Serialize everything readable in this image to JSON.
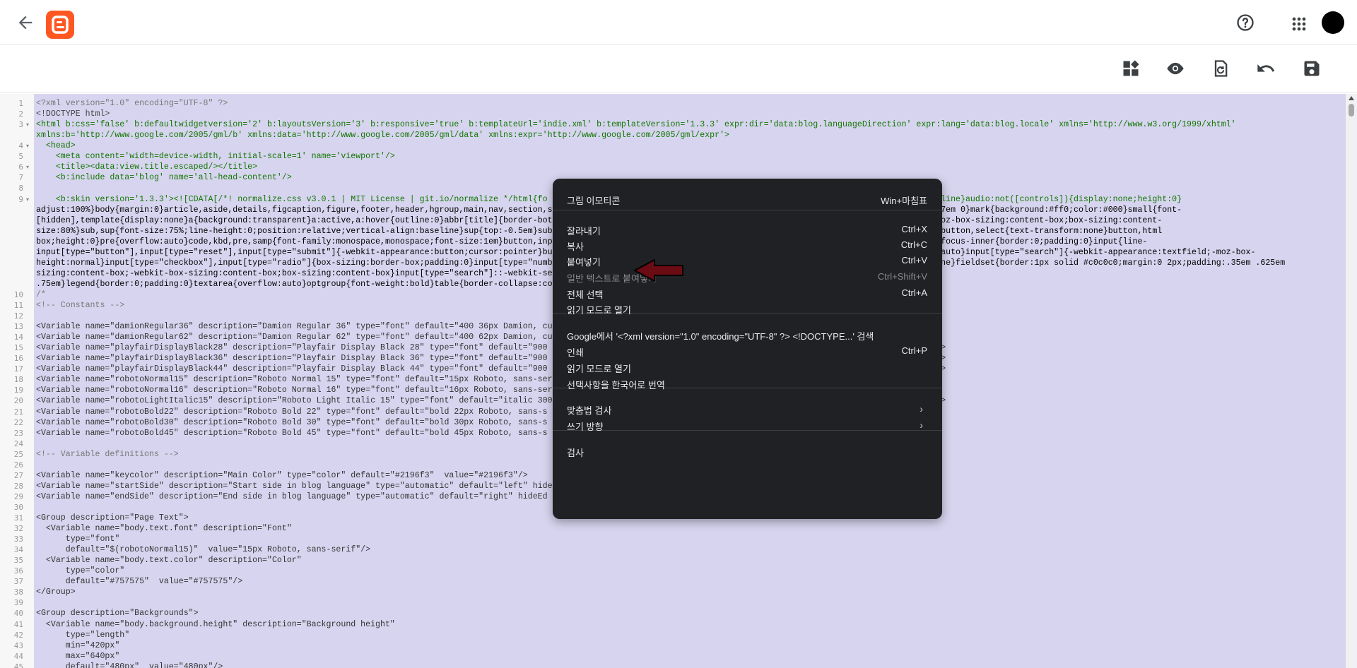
{
  "header": {
    "back_icon": "arrow-left-icon",
    "logo_icon": "blogger-logo-icon",
    "help_icon": "help-circle-icon",
    "apps_icon": "apps-grid-icon",
    "avatar_color": "#000000"
  },
  "toolbar": {
    "icons": [
      "widgets-icon",
      "preview-eye-icon",
      "restore-icon",
      "undo-icon",
      "save-icon"
    ]
  },
  "editor": {
    "lines": [
      {
        "n": "1",
        "fold": "",
        "text": "<?xml version=\"1.0\" encoding=\"UTF-8\" ?>",
        "color": "#777777"
      },
      {
        "n": "2",
        "fold": "",
        "text": "<!DOCTYPE html>",
        "color": "#444444"
      },
      {
        "n": "3",
        "fold": "▾",
        "text": "<html b:css='false' b:defaultwidgetversion='2' b:layoutsVersion='3' b:responsive='true' b:templateUrl='indie.xml' b:templateVersion='1.3.3' expr:dir='data:blog.languageDirection' expr:lang='data:blog.locale' xmlns='http://www.w3.org/1999/xhtml'",
        "color": "#117700"
      },
      {
        "n": "",
        "fold": "",
        "text": "xmlns:b='http://www.google.com/2005/gml/b' xmlns:data='http://www.google.com/2005/gml/data' xmlns:expr='http://www.google.com/2005/gml/expr'>",
        "color": "#117700"
      },
      {
        "n": "4",
        "fold": "▾",
        "text": "  <head>",
        "color": "#117700"
      },
      {
        "n": "5",
        "fold": "",
        "text": "    <meta content='width=device-width, initial-scale=1' name='viewport'/>",
        "color": "#117700"
      },
      {
        "n": "6",
        "fold": "▾",
        "text": "    <title><data:view.title.escaped/></title>",
        "color": "#117700"
      },
      {
        "n": "7",
        "fold": "",
        "text": "    <b:include data='blog' name='all-head-content'/>",
        "color": "#117700"
      },
      {
        "n": "8",
        "fold": "",
        "text": "",
        "color": "#000000"
      },
      {
        "n": "9",
        "fold": "▾",
        "text": "    <b:skin version='1.3.3'><![CDATA[/*! normalize.css v3.0.1 | MIT License | git.io/normalize */html{fo                                                                     -align:baseline}audio:not([controls]){display:none;height:0}",
        "color": "#117700"
      },
      {
        "n": "",
        "fold": "",
        "text": "adjust:100%}body{margin:0}article,aside,details,figcaption,figure,footer,header,hgroup,main,nav,section,s                                                                     ;margin:.67em 0}mark{background:#ff0;color:#000}small{font-",
        "color": "#000000"
      },
      {
        "n": "",
        "fold": "",
        "text": "[hidden],template{display:none}a{background:transparent}a:active,a:hover{outline:0}abbr[title]{border-bot                                                                     40px}hr{-moz-box-sizing:content-box;box-sizing:content-",
        "color": "#000000"
      },
      {
        "n": "",
        "fold": "",
        "text": "size:80%}sub,sup{font-size:75%;line-height:0;position:relative;vertical-align:baseline}sup{top:-0.5em}sub                                                                     w:visible}button,select{text-transform:none}button,html",
        "color": "#000000"
      },
      {
        "n": "",
        "fold": "",
        "text": "box;height:0}pre{overflow:auto}code,kbd,pre,samp{font-family:monospace,monospace;font-size:1em}button,inp                                                                     put::-moz-focus-inner{border:0;padding:0}input{line-",
        "color": "#000000"
      },
      {
        "n": "",
        "fold": "",
        "text": "input[type=\"button\"],input[type=\"reset\"],input[type=\"submit\"]{-webkit-appearance:button;cursor:pointer}bu                                                                     ::{height:auto}input[type=\"search\"]{-webkit-appearance:textfield;-moz-box-",
        "color": "#000000"
      },
      {
        "n": "",
        "fold": "",
        "text": "height:normal}input[type=\"checkbox\"],input[type=\"radio\"]{box-sizing:border-box;padding:0}input[type=\"numb                                                                     earance:none}fieldset{border:1px solid #c0c0c0;margin:0 2px;padding:.35em .625em",
        "color": "#000000"
      },
      {
        "n": "",
        "fold": "",
        "text": "sizing:content-box;-webkit-box-sizing:content-box;box-sizing:content-box}input[type=\"search\"]::-webkit-se",
        "color": "#000000"
      },
      {
        "n": "",
        "fold": "",
        "text": ".75em}legend{border:0;padding:0}textarea{overflow:auto}optgroup{font-weight:bold}table{border-collapse:co",
        "color": "#000000"
      },
      {
        "n": "10",
        "fold": "",
        "text": "/*",
        "color": "#777777"
      },
      {
        "n": "11",
        "fold": "",
        "text": "<!-- Constants -->",
        "color": "#777777"
      },
      {
        "n": "12",
        "fold": "",
        "text": "",
        "color": "#000000"
      },
      {
        "n": "13",
        "fold": "",
        "text": "<Variable name=\"damionRegular36\" description=\"Damion Regular 36\" type=\"font\" default=\"400 36px Damion, cu",
        "color": "#333333"
      },
      {
        "n": "14",
        "fold": "",
        "text": "<Variable name=\"damionRegular62\" description=\"Damion Regular 62\" type=\"font\" default=\"400 62px Damion, cu",
        "color": "#333333"
      },
      {
        "n": "15",
        "fold": "",
        "text": "<Variable name=\"playfairDisplayBlack28\" description=\"Playfair Display Black 28\" type=\"font\" default=\"900                                                                    lay, serif\"/>",
        "color": "#333333"
      },
      {
        "n": "16",
        "fold": "",
        "text": "<Variable name=\"playfairDisplayBlack36\" description=\"Playfair Display Black 36\" type=\"font\" default=\"900                                                                    lay, serif\"/>",
        "color": "#333333"
      },
      {
        "n": "17",
        "fold": "",
        "text": "<Variable name=\"playfairDisplayBlack44\" description=\"Playfair Display Black 44\" type=\"font\" default=\"900                                                                    lay, serif\"/>",
        "color": "#333333"
      },
      {
        "n": "18",
        "fold": "",
        "text": "<Variable name=\"robotoNormal15\" description=\"Roboto Normal 15\" type=\"font\" default=\"15px Roboto, sans-ser",
        "color": "#333333"
      },
      {
        "n": "19",
        "fold": "",
        "text": "<Variable name=\"robotoNormal16\" description=\"Roboto Normal 16\" type=\"font\" default=\"16px Roboto, sans-ser",
        "color": "#333333"
      },
      {
        "n": "20",
        "fold": "",
        "text": "<Variable name=\"robotoLightItalic15\" description=\"Roboto Light Italic 15\" type=\"font\" default=\"italic 300                                                                     ns-serif\"/>",
        "color": "#333333"
      },
      {
        "n": "21",
        "fold": "",
        "text": "<Variable name=\"robotoBold22\" description=\"Roboto Bold 22\" type=\"font\" default=\"bold 22px Roboto, sans-s",
        "color": "#333333"
      },
      {
        "n": "22",
        "fold": "",
        "text": "<Variable name=\"robotoBold30\" description=\"Roboto Bold 30\" type=\"font\" default=\"bold 30px Roboto, sans-s",
        "color": "#333333"
      },
      {
        "n": "23",
        "fold": "",
        "text": "<Variable name=\"robotoBold45\" description=\"Roboto Bold 45\" type=\"font\" default=\"bold 45px Roboto, sans-s",
        "color": "#333333"
      },
      {
        "n": "24",
        "fold": "",
        "text": "",
        "color": "#000000"
      },
      {
        "n": "25",
        "fold": "",
        "text": "<!-- Variable definitions -->",
        "color": "#777777"
      },
      {
        "n": "26",
        "fold": "",
        "text": "",
        "color": "#000000"
      },
      {
        "n": "27",
        "fold": "",
        "text": "<Variable name=\"keycolor\" description=\"Main Color\" type=\"color\" default=\"#2196f3\"  value=\"#2196f3\"/>",
        "color": "#333333"
      },
      {
        "n": "28",
        "fold": "",
        "text": "<Variable name=\"startSide\" description=\"Start side in blog language\" type=\"automatic\" default=\"left\" hide",
        "color": "#333333"
      },
      {
        "n": "29",
        "fold": "",
        "text": "<Variable name=\"endSide\" description=\"End side in blog language\" type=\"automatic\" default=\"right\" hideEd",
        "color": "#333333"
      },
      {
        "n": "30",
        "fold": "",
        "text": "",
        "color": "#000000"
      },
      {
        "n": "31",
        "fold": "",
        "text": "<Group description=\"Page Text\">",
        "color": "#333333"
      },
      {
        "n": "32",
        "fold": "",
        "text": "  <Variable name=\"body.text.font\" description=\"Font\"",
        "color": "#333333"
      },
      {
        "n": "33",
        "fold": "",
        "text": "      type=\"font\"",
        "color": "#333333"
      },
      {
        "n": "34",
        "fold": "",
        "text": "      default=\"$(robotoNormal15)\"  value=\"15px Roboto, sans-serif\"/>",
        "color": "#333333"
      },
      {
        "n": "35",
        "fold": "",
        "text": "  <Variable name=\"body.text.color\" description=\"Color\"",
        "color": "#333333"
      },
      {
        "n": "36",
        "fold": "",
        "text": "      type=\"color\"",
        "color": "#333333"
      },
      {
        "n": "37",
        "fold": "",
        "text": "      default=\"#757575\"  value=\"#757575\"/>",
        "color": "#333333"
      },
      {
        "n": "38",
        "fold": "",
        "text": "</Group>",
        "color": "#333333"
      },
      {
        "n": "39",
        "fold": "",
        "text": "",
        "color": "#000000"
      },
      {
        "n": "40",
        "fold": "",
        "text": "<Group description=\"Backgrounds\">",
        "color": "#333333"
      },
      {
        "n": "41",
        "fold": "",
        "text": "  <Variable name=\"body.background.height\" description=\"Background height\"",
        "color": "#333333"
      },
      {
        "n": "42",
        "fold": "",
        "text": "      type=\"length\"",
        "color": "#333333"
      },
      {
        "n": "43",
        "fold": "",
        "text": "      min=\"420px\"",
        "color": "#333333"
      },
      {
        "n": "44",
        "fold": "",
        "text": "      max=\"640px\"",
        "color": "#333333"
      },
      {
        "n": "45",
        "fold": "",
        "text": "      default=\"480px\"  value=\"480px\"/>",
        "color": "#333333"
      }
    ],
    "selection_color": "#d7d4ef"
  },
  "context_menu": {
    "items": [
      {
        "label": "그림 이모티콘",
        "shortcut": "Win+마침표",
        "disabled": false,
        "sub": false
      },
      {
        "label": "잘라내기",
        "shortcut": "Ctrl+X",
        "disabled": false,
        "sub": false
      },
      {
        "label": "복사",
        "shortcut": "Ctrl+C",
        "disabled": false,
        "sub": false
      },
      {
        "label": "붙여넣기",
        "shortcut": "Ctrl+V",
        "disabled": false,
        "sub": false
      },
      {
        "label": "일반 텍스트로 붙여넣기",
        "shortcut": "Ctrl+Shift+V",
        "disabled": true,
        "sub": false
      },
      {
        "label": "전체 선택",
        "shortcut": "Ctrl+A",
        "disabled": false,
        "sub": false
      },
      {
        "label": "읽기 모드로 열기",
        "shortcut": "",
        "disabled": false,
        "sub": false
      },
      {
        "label": "Google에서 '<?xml version=\"1.0\" encoding=\"UTF-8\" ?> <!DOCTYPE...' 검색",
        "shortcut": "",
        "disabled": false,
        "sub": false
      },
      {
        "label": "인쇄",
        "shortcut": "Ctrl+P",
        "disabled": false,
        "sub": false
      },
      {
        "label": "읽기 모드로 열기",
        "shortcut": "",
        "disabled": false,
        "sub": false
      },
      {
        "label": "선택사항을 한국어로 번역",
        "shortcut": "",
        "disabled": false,
        "sub": false
      },
      {
        "label": "맞춤법 검사",
        "shortcut": "",
        "disabled": false,
        "sub": true
      },
      {
        "label": "쓰기 방향",
        "shortcut": "",
        "disabled": false,
        "sub": true
      },
      {
        "label": "검사",
        "shortcut": "",
        "disabled": false,
        "sub": false
      }
    ],
    "background": "#202124"
  },
  "annotation": {
    "icon": "red-arrow-icon",
    "color": "#6b0b14"
  }
}
